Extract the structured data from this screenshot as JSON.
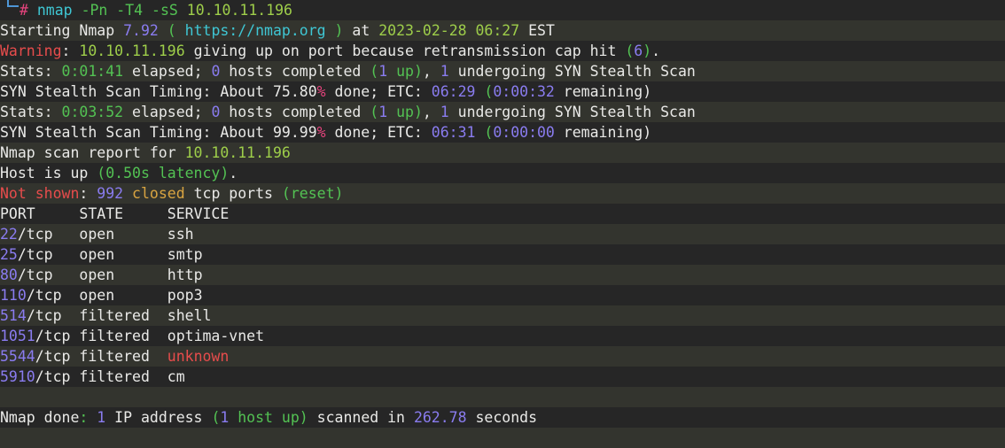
{
  "terminal": {
    "theme": {
      "bg_dark": "#262626",
      "bg_light": "#33342e",
      "fg": "#e9e9e7",
      "green": "#53c253",
      "light_green": "#9ece4a",
      "purple": "#8a7cf0",
      "cyan": "#3fc7d4",
      "red": "#e74c4c",
      "magenta": "#e8447e",
      "gold": "#d9a441",
      "prompt_rule": "#4e96d6"
    },
    "prompt": {
      "symbol": "#",
      "command": "nmap",
      "flags": "-Pn -T4 -sS",
      "target": "10.10.11.196"
    },
    "lines": {
      "starting": {
        "label": "Starting Nmap ",
        "version": "7.92",
        "paren_open": " ( ",
        "url": "https://nmap.org",
        "paren_close": " ) ",
        "at": "at ",
        "datetime": "2023-02-28 06:27",
        "tz": " EST"
      },
      "warning": {
        "tag": "Warning",
        "colon": ": ",
        "ip": "10.10.11.196",
        "text": " giving up on port because retransmission cap hit ",
        "paren_open": "(",
        "count": "6",
        "paren_close": ")",
        "period": "."
      },
      "stats1": {
        "label": "Stats: ",
        "elapsed": "0:01:41",
        "mid": " elapsed; ",
        "hosts": "0",
        "completed": " hosts completed ",
        "paren_open": "(",
        "up_count": "1",
        "up_text": " up)",
        "comma": ", ",
        "undergoing_count": "1",
        "undergoing": " undergoing SYN Stealth Scan"
      },
      "timing1": {
        "label": "SYN Stealth Scan Timing: About ",
        "percent": "75.80",
        "pct_sign": "%",
        "done": " done; ETC: ",
        "etc": "06:29",
        "space": " ",
        "paren_open": "(",
        "remaining_time": "0:00:32",
        "remaining_text": " remaining)"
      },
      "stats2": {
        "label": "Stats: ",
        "elapsed": "0:03:52",
        "mid": " elapsed; ",
        "hosts": "0",
        "completed": " hosts completed ",
        "paren_open": "(",
        "up_count": "1",
        "up_text": " up)",
        "comma": ", ",
        "undergoing_count": "1",
        "undergoing": " undergoing SYN Stealth Scan"
      },
      "timing2": {
        "label": "SYN Stealth Scan Timing: About ",
        "percent": "99.99",
        "pct_sign": "%",
        "done": " done; ETC: ",
        "etc": "06:31",
        "space": " ",
        "paren_open": "(",
        "remaining_time": "0:00:00",
        "remaining_text": " remaining)"
      },
      "report": {
        "label": "Nmap scan report for ",
        "ip": "10.10.11.196"
      },
      "hostup": {
        "label": "Host is up ",
        "paren": "(0.50s latency)",
        "period": "."
      },
      "notshown": {
        "tag": "Not shown",
        "colon": ": ",
        "count": "992",
        "space1": " ",
        "state": "closed",
        "text": " tcp ports ",
        "reason": "(reset)"
      },
      "done": {
        "label": "Nmap done",
        "colon": ": ",
        "ip_count": "1",
        "ip_text": " IP address ",
        "paren_open": "(",
        "host_count": "1",
        "host_text": " host up)",
        "scanned": " scanned in ",
        "seconds": "262.78",
        "unit": " seconds"
      }
    },
    "table": {
      "headers": {
        "port": "PORT",
        "state": "STATE",
        "service": "SERVICE"
      },
      "rows": [
        {
          "port": "22",
          "proto": "/tcp",
          "state": "open",
          "service": "ssh",
          "service_unknown": false
        },
        {
          "port": "25",
          "proto": "/tcp",
          "state": "open",
          "service": "smtp",
          "service_unknown": false
        },
        {
          "port": "80",
          "proto": "/tcp",
          "state": "open",
          "service": "http",
          "service_unknown": false
        },
        {
          "port": "110",
          "proto": "/tcp",
          "state": "open",
          "service": "pop3",
          "service_unknown": false
        },
        {
          "port": "514",
          "proto": "/tcp",
          "state": "filtered",
          "service": "shell",
          "service_unknown": false
        },
        {
          "port": "1051",
          "proto": "/tcp",
          "state": "filtered",
          "service": "optima-vnet",
          "service_unknown": false
        },
        {
          "port": "5544",
          "proto": "/tcp",
          "state": "filtered",
          "service": "unknown",
          "service_unknown": true
        },
        {
          "port": "5910",
          "proto": "/tcp",
          "state": "filtered",
          "service": "cm",
          "service_unknown": false
        }
      ]
    }
  }
}
